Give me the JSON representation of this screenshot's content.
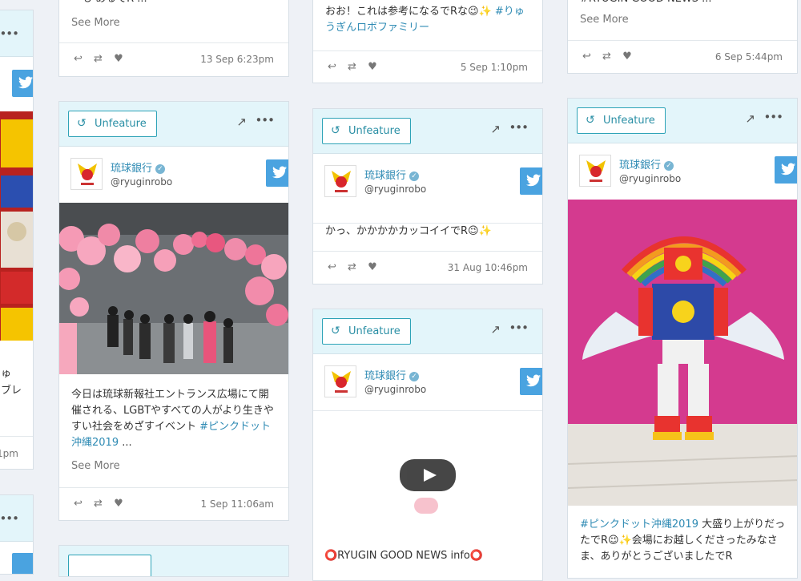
{
  "colors": {
    "page_bg": "#eef1f6",
    "accent": "#2ea3b7",
    "twitter_blue": "#4aa3e0",
    "link": "#2f8bb4"
  },
  "icons": {
    "unfeature": "refresh-icon",
    "share": "external-arrow-icon",
    "more": "ellipsis-icon",
    "reply": "reply-icon",
    "retweet": "retweet-icon",
    "like": "heart-icon",
    "network": "twitter-icon",
    "verified": "check-badge-icon"
  },
  "common": {
    "unfeature_label": "Unfeature",
    "see_more": "See More",
    "author_name": "琉球銀行",
    "author_handle": "@ryuginrobo",
    "share_glyph": "↗",
    "more_glyph": "•••",
    "reply_glyph": "↩",
    "retweet_glyph": "⇄",
    "like_glyph": "♥",
    "verified_glyph": "✓",
    "play_label": "▶"
  },
  "left_partial": {
    "text_line1": "ゅ",
    "text_line2": "ブレ",
    "date_fragment": "1pm"
  },
  "col1_top": {
    "text_fragment": "ーも あるでR ...",
    "date": "13 Sep 6:23pm"
  },
  "col1_post": {
    "text_plain": "今日は琉球新報社エントランス広場にて開催される、LGBTやすべての人がより生きやすい社会をめざすイベント ",
    "text_tag": "#ピンクドット沖縄2019",
    "text_tail": " ...",
    "date": "1 Sep 11:06am"
  },
  "col2_top": {
    "text_plain": "おお！これは参考になるでRな😉✨ ",
    "text_tag": "#りゅうぎんロボファミリー",
    "date": "5 Sep 1:10pm"
  },
  "col2_post": {
    "text": "かっ、かかかかカッコイイでR😉✨",
    "date": "31 Aug 10:46pm"
  },
  "col2_video": {
    "caption": "⭕RYUGIN GOOD NEWS info⭕"
  },
  "col3_top": {
    "text_fragment": "#RYUGIN GOOD NEWS ...",
    "date": "6 Sep 5:44pm"
  },
  "col3_post": {
    "text_tag": "#ピンクドット沖縄2019",
    "text_plain": " 大盛り上がりだったでR😉✨会場にお越しくださったみなさま、ありがとうございましたでR"
  }
}
